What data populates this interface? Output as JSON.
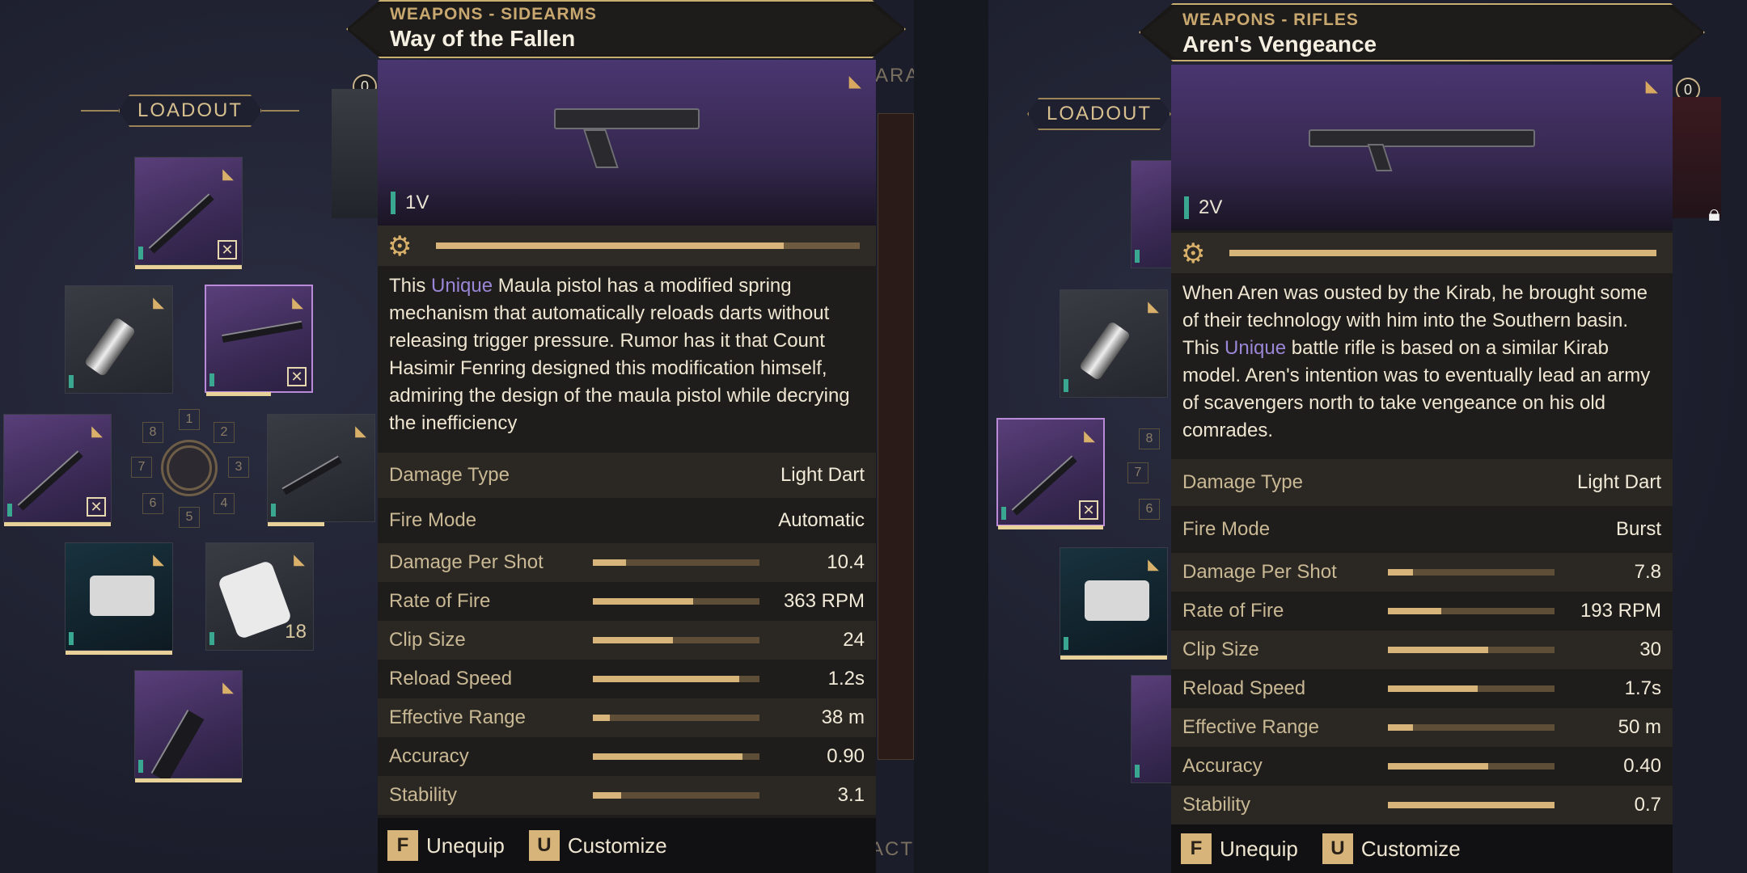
{
  "left": {
    "loadout_title": "LOADOUT",
    "loadout_count": "0",
    "behind_tab": "ARA",
    "behind_bottom": "CHARACT",
    "wheel_numbers": [
      "1",
      "2",
      "3",
      "4",
      "5",
      "6",
      "7",
      "8"
    ],
    "consumable_count": "18",
    "item": {
      "category": "WEAPONS - SIDEARMS",
      "name": "Way of the Fallen",
      "tier": "1V",
      "durability": 0.82,
      "description_pre": "This",
      "description_unique": "Unique",
      "description_post": "Maula pistol has a modified spring mechanism that automatically reloads darts without releasing trigger pressure. Rumor has it that Count Hasimir Fenring designed this modification himself, admiring the design of the maula pistol while decrying the inefficiency",
      "damage_type_label": "Damage Type",
      "damage_type": "Light Dart",
      "fire_mode_label": "Fire Mode",
      "fire_mode": "Automatic",
      "stats": [
        {
          "label": "Damage Per Shot",
          "value": "10.4",
          "fill": 0.2
        },
        {
          "label": "Rate of Fire",
          "value": "363 RPM",
          "fill": 0.6
        },
        {
          "label": "Clip Size",
          "value": "24",
          "fill": 0.48
        },
        {
          "label": "Reload Speed",
          "value": "1.2s",
          "fill": 0.88
        },
        {
          "label": "Effective Range",
          "value": "38 m",
          "fill": 0.1
        },
        {
          "label": "Accuracy",
          "value": "0.90",
          "fill": 0.9
        },
        {
          "label": "Stability",
          "value": "3.1",
          "fill": 0.17
        }
      ],
      "actions": [
        {
          "key": "F",
          "label": "Unequip"
        },
        {
          "key": "U",
          "label": "Customize"
        }
      ]
    }
  },
  "right": {
    "loadout_title": "LOADOUT",
    "loadout_count": "0",
    "wheel_numbers": [
      "8",
      "7",
      "6"
    ],
    "item": {
      "category": "WEAPONS - RIFLES",
      "name": "Aren's Vengeance",
      "tier": "2V",
      "durability": 1.0,
      "description_pre": "When Aren was ousted by the Kirab, he brought some of their technology with him into the Southern basin. This",
      "description_unique": "Unique",
      "description_post": "battle rifle is based on a similar Kirab model. Aren's intention was to eventually lead an army of scavengers north to take vengeance on his old comrades.",
      "damage_type_label": "Damage Type",
      "damage_type": "Light Dart",
      "fire_mode_label": "Fire Mode",
      "fire_mode": "Burst",
      "stats": [
        {
          "label": "Damage Per Shot",
          "value": "7.8",
          "fill": 0.15
        },
        {
          "label": "Rate of Fire",
          "value": "193 RPM",
          "fill": 0.32
        },
        {
          "label": "Clip Size",
          "value": "30",
          "fill": 0.6
        },
        {
          "label": "Reload Speed",
          "value": "1.7s",
          "fill": 0.54
        },
        {
          "label": "Effective Range",
          "value": "50 m",
          "fill": 0.15
        },
        {
          "label": "Accuracy",
          "value": "0.40",
          "fill": 0.6
        },
        {
          "label": "Stability",
          "value": "0.7",
          "fill": 1.0
        }
      ],
      "actions": [
        {
          "key": "F",
          "label": "Unequip"
        },
        {
          "key": "U",
          "label": "Customize"
        }
      ]
    }
  },
  "colors": {
    "accent": "#d6b47a",
    "unique": "#9a86d6",
    "tier": "#3aa890"
  },
  "icons": [
    "gear-icon",
    "lock-icon",
    "favorite-icon",
    "sidearm-icon",
    "rifle-icon"
  ]
}
